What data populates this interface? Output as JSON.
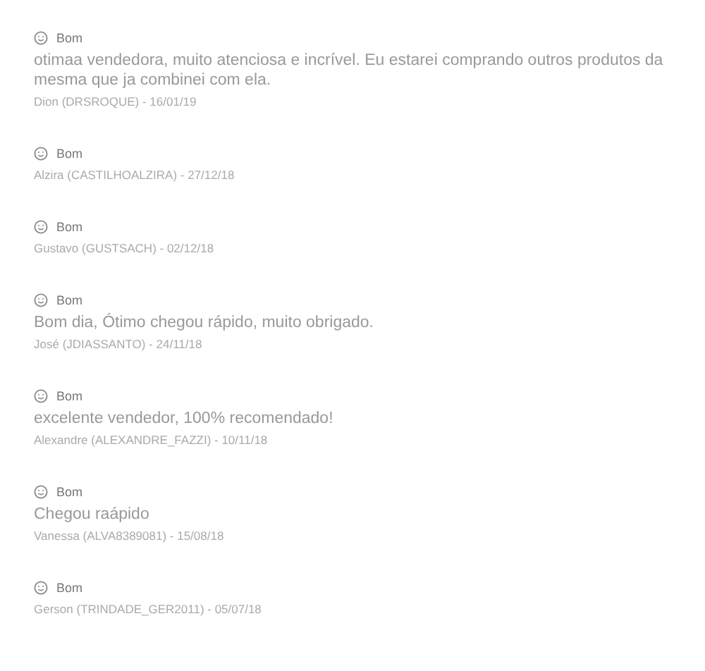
{
  "reviews": [
    {
      "rating": "Bom",
      "comment": "otimaa vendedora, muito atenciosa e incrível. Eu estarei comprando outros produtos da mesma que ja combinei com ela.",
      "author": "Dion (DRSROQUE) - 16/01/19"
    },
    {
      "rating": "Bom",
      "author": "Alzira (CASTILHOALZIRA) - 27/12/18"
    },
    {
      "rating": "Bom",
      "author": "Gustavo (GUSTSACH) - 02/12/18"
    },
    {
      "rating": "Bom",
      "comment": "Bom dia, Ótimo chegou rápido, muito obrigado.",
      "author": "José (JDIASSANTO) - 24/11/18"
    },
    {
      "rating": "Bom",
      "comment": "excelente vendedor, 100% recomendado!",
      "author": "Alexandre (ALEXANDRE_FAZZI) - 10/11/18"
    },
    {
      "rating": "Bom",
      "comment": "Chegou raápido",
      "author": "Vanessa (ALVA8389081) - 15/08/18"
    },
    {
      "rating": "Bom",
      "author": "Gerson (TRINDADE_GER2011) - 05/07/18"
    }
  ]
}
